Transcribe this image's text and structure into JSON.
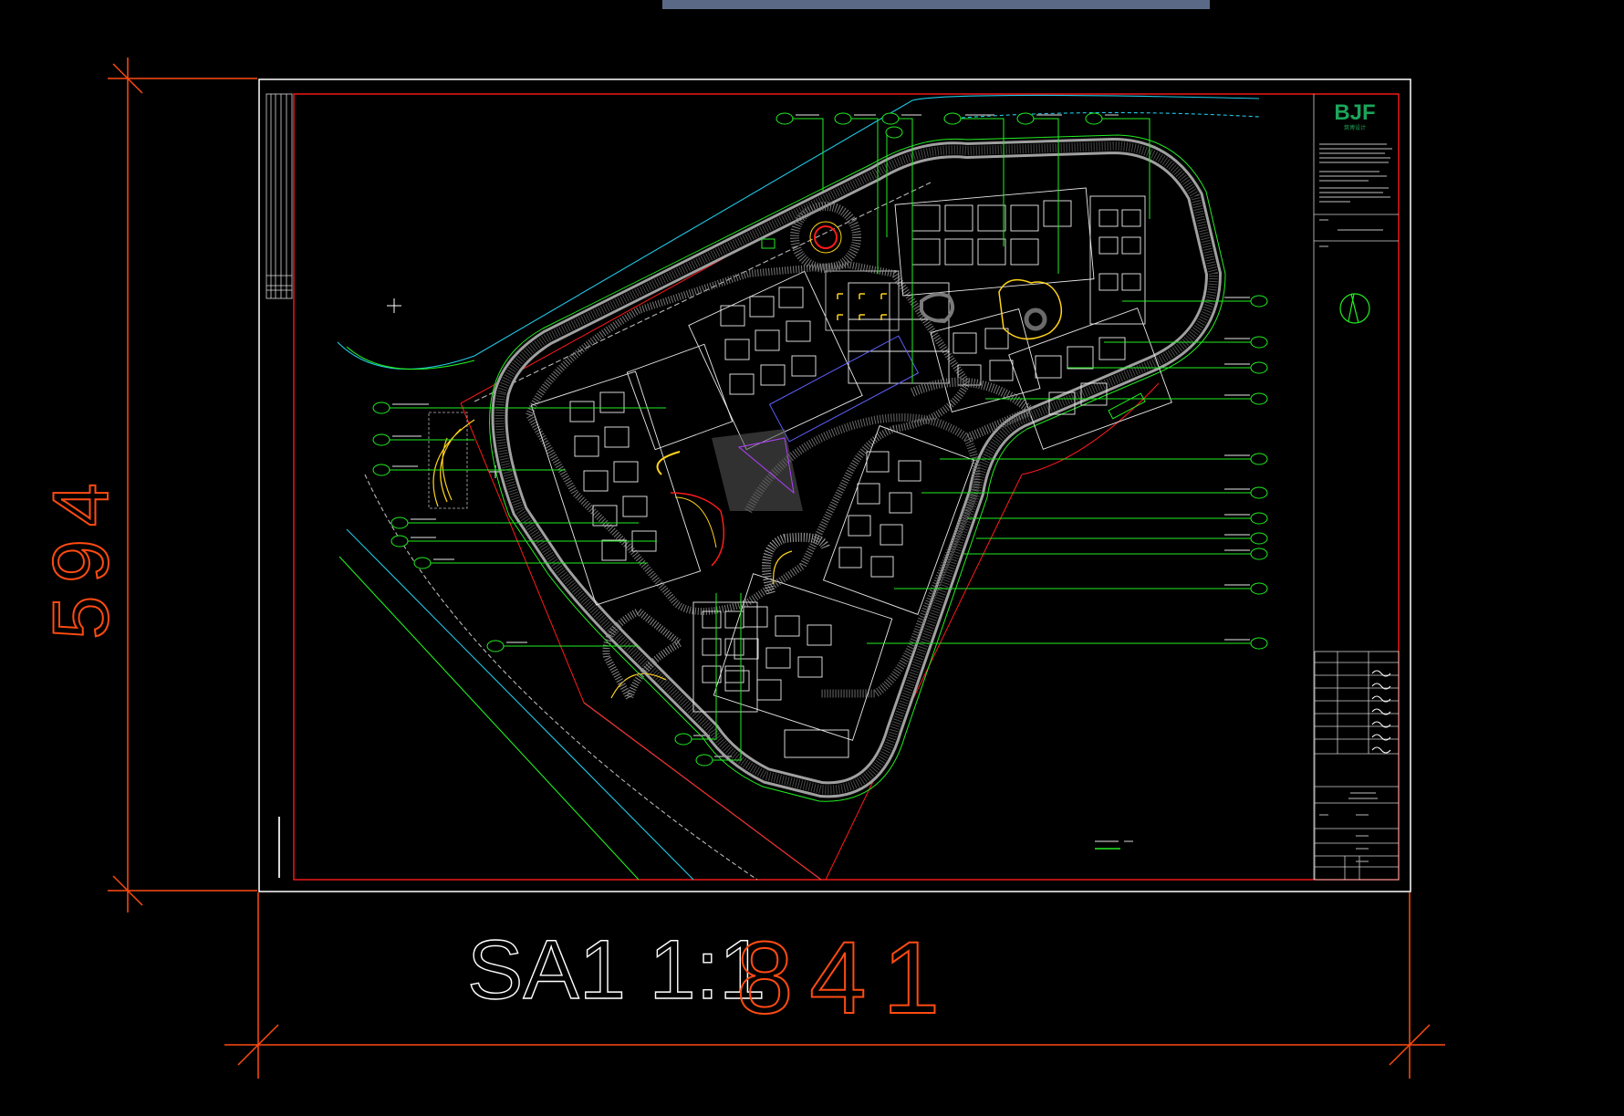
{
  "dimensions": {
    "height_label": "594",
    "width_label": "841",
    "scale_label": "SA1 1:1"
  },
  "title_block": {
    "logo": "BJF",
    "logo_sub": "筑博设计"
  },
  "colors": {
    "background": "#000000",
    "dimension": "#ff4b12",
    "sheet_border": "#ffffff",
    "frame": "#ff1a1a",
    "leader": "#22ee22",
    "site_line": "#21c9e8",
    "path": "#b9b9b9",
    "building": "#eaeaea",
    "accent_yellow": "#ffd21a",
    "brand": "#1aa55a",
    "toolbar": "#5a6a86"
  },
  "icons": {
    "compass": "north-arrow-icon",
    "crosshair": "crosshair-icon"
  }
}
